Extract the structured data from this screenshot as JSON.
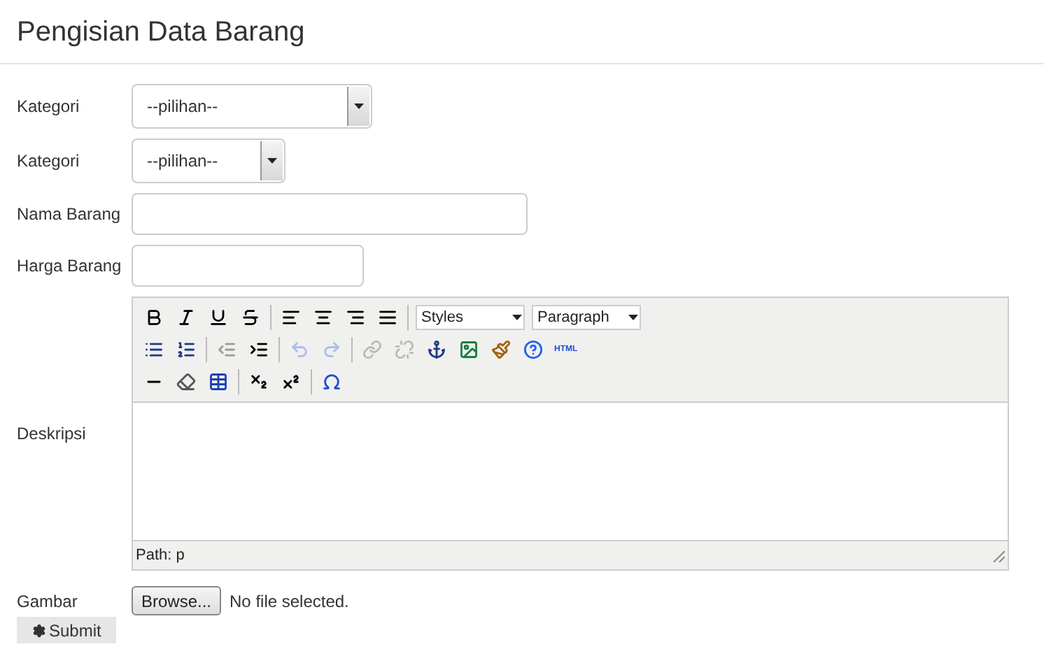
{
  "title": "Pengisian Data Barang",
  "fields": [
    {
      "kind": "select",
      "label": "Kategori",
      "value": "--pilihan--"
    },
    {
      "kind": "select",
      "label": "Kategori",
      "value": "--pilihan--"
    },
    {
      "kind": "text",
      "label": "Nama Barang"
    },
    {
      "kind": "text",
      "label": "Harga Barang"
    }
  ],
  "editor": {
    "label": "Deskripsi",
    "toolbar": [
      [
        {
          "kind": "bold",
          "disabled": false
        },
        {
          "kind": "italic",
          "disabled": false
        },
        {
          "kind": "underline",
          "disabled": false
        },
        {
          "kind": "strike",
          "disabled": false
        },
        {
          "kind": "sep"
        },
        {
          "kind": "align-left",
          "disabled": false
        },
        {
          "kind": "align-center",
          "disabled": false
        },
        {
          "kind": "align-right",
          "disabled": false
        },
        {
          "kind": "justify",
          "disabled": false
        },
        {
          "kind": "sep"
        },
        {
          "kind": "select",
          "value": "Styles"
        },
        {
          "kind": "select",
          "value": "Paragraph"
        }
      ],
      [
        {
          "kind": "bullets",
          "disabled": false
        },
        {
          "kind": "numbers",
          "disabled": false
        },
        {
          "kind": "sep"
        },
        {
          "kind": "outdent",
          "disabled": true
        },
        {
          "kind": "indent",
          "disabled": false
        },
        {
          "kind": "sep"
        },
        {
          "kind": "undo",
          "disabled": true
        },
        {
          "kind": "redo",
          "disabled": true
        },
        {
          "kind": "sep"
        },
        {
          "kind": "link",
          "disabled": true
        },
        {
          "kind": "unlink",
          "disabled": true
        },
        {
          "kind": "anchor",
          "disabled": false
        },
        {
          "kind": "image",
          "disabled": false
        },
        {
          "kind": "cleanup",
          "disabled": false
        },
        {
          "kind": "help",
          "disabled": false
        },
        {
          "kind": "html",
          "text": "HTML",
          "disabled": false
        }
      ],
      [
        {
          "kind": "rule",
          "disabled": false
        },
        {
          "kind": "eraser",
          "disabled": false
        },
        {
          "kind": "table",
          "disabled": false
        },
        {
          "kind": "sep"
        },
        {
          "kind": "subscript",
          "disabled": false
        },
        {
          "kind": "superscript",
          "disabled": false
        },
        {
          "kind": "sep"
        },
        {
          "kind": "omega",
          "disabled": false
        }
      ]
    ],
    "path": "Path: p"
  },
  "image": {
    "label": "Gambar",
    "button": "Browse...",
    "status": "No file selected."
  },
  "submit": "Submit"
}
